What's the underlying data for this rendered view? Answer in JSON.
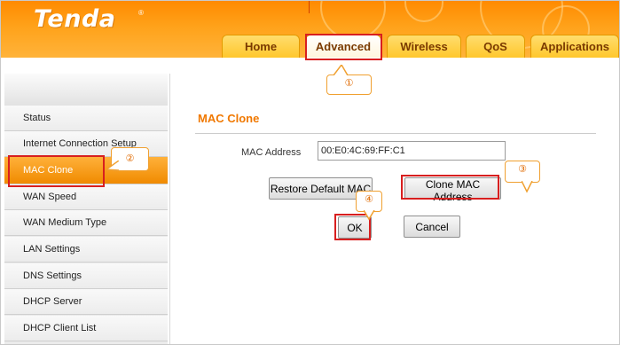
{
  "header": {
    "logo": "Tenda",
    "logo_mark": "®",
    "tabs": [
      "Home",
      "Advanced",
      "Wireless",
      "QoS",
      "Applications"
    ]
  },
  "sidebar": {
    "items": [
      {
        "label": "Status"
      },
      {
        "label": "Internet Connection Setup"
      },
      {
        "label": "MAC Clone"
      },
      {
        "label": "WAN Speed"
      },
      {
        "label": "WAN Medium Type"
      },
      {
        "label": "LAN Settings"
      },
      {
        "label": "DNS Settings"
      },
      {
        "label": "DHCP Server"
      },
      {
        "label": "DHCP Client List"
      }
    ]
  },
  "main": {
    "title": "MAC Clone",
    "mac_label": "MAC Address",
    "mac_value": "00:E0:4C:69:FF:C1",
    "restore_button": "Restore Default MAC",
    "clone_button": "Clone MAC Address",
    "ok_button": "OK",
    "cancel_button": "Cancel"
  },
  "annotations": {
    "step1": "①",
    "step2": "②",
    "step3": "③",
    "step4": "④"
  },
  "colors": {
    "header_orange": "#ff9a10",
    "accent": "#f07800",
    "annotation_red": "#d81f1f",
    "callout_border": "#f0a030"
  }
}
